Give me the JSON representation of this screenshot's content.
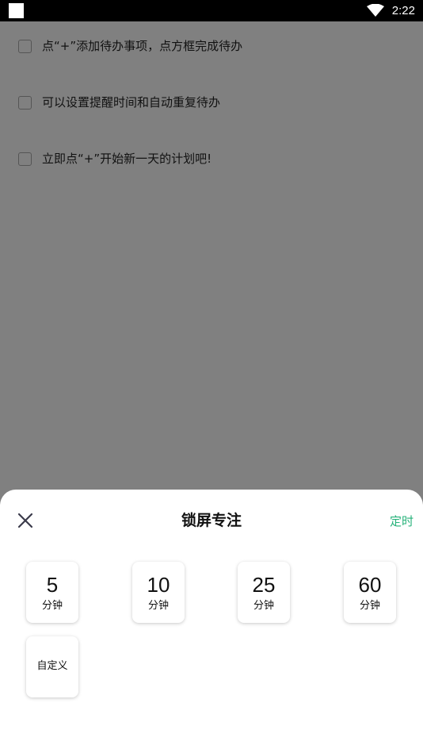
{
  "status_bar": {
    "time": "2:22"
  },
  "todos": [
    {
      "text": "点“+”添加待办事项，点方框完成待办",
      "checked": false
    },
    {
      "text": "可以设置提醒时间和自动重复待办",
      "checked": false
    },
    {
      "text": "立即点“+”开始新一天的计划吧!",
      "checked": false
    }
  ],
  "sheet": {
    "title": "锁屏专注",
    "action_label": "定时",
    "close_icon": "close-icon",
    "accent_color": "#27b27a",
    "options": [
      {
        "value": "5",
        "unit": "分钟"
      },
      {
        "value": "10",
        "unit": "分钟"
      },
      {
        "value": "25",
        "unit": "分钟"
      },
      {
        "value": "60",
        "unit": "分钟"
      }
    ],
    "custom_label": "自定义"
  }
}
